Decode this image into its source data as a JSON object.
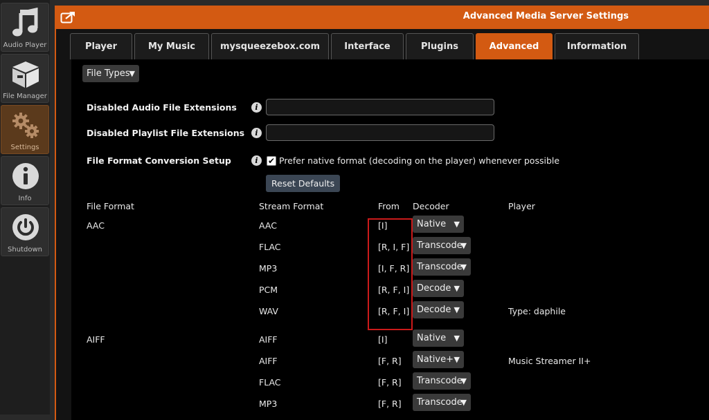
{
  "sidebar": {
    "items": [
      {
        "label": "Audio Player",
        "icon": "music-note-icon",
        "active": false
      },
      {
        "label": "File Manager",
        "icon": "box-icon",
        "active": false
      },
      {
        "label": "Settings",
        "icon": "gears-icon",
        "active": true
      },
      {
        "label": "Info",
        "icon": "info-icon",
        "active": false
      },
      {
        "label": "Shutdown",
        "icon": "power-icon",
        "active": false
      }
    ]
  },
  "window": {
    "title": "Advanced Media Server Settings",
    "accent": "#d35a12"
  },
  "tabs": [
    {
      "label": "Player"
    },
    {
      "label": "My Music"
    },
    {
      "label": "mysqueezebox.com"
    },
    {
      "label": "Interface"
    },
    {
      "label": "Plugins"
    },
    {
      "label": "Advanced",
      "active": true
    },
    {
      "label": "Information"
    }
  ],
  "section_dropdown": {
    "label": "File Types"
  },
  "settings": {
    "disabled_audio": {
      "label": "Disabled Audio File Extensions",
      "value": ""
    },
    "disabled_playlist": {
      "label": "Disabled Playlist File Extensions",
      "value": ""
    },
    "conversion": {
      "label": "File Format Conversion Setup",
      "checkbox_label": "Prefer native format (decoding on the player) whenever possible",
      "checked": true,
      "reset_label": "Reset Defaults"
    }
  },
  "table": {
    "headers": {
      "file_format": "File Format",
      "stream_format": "Stream Format",
      "from": "From",
      "decoder": "Decoder",
      "player": "Player"
    },
    "rows": [
      {
        "file_format": "AAC",
        "stream_format": "AAC",
        "from": "[I]",
        "decoder": "Native",
        "player": ""
      },
      {
        "file_format": "",
        "stream_format": "FLAC",
        "from": "[R, I, F]",
        "decoder": "Transcode",
        "player": ""
      },
      {
        "file_format": "",
        "stream_format": "MP3",
        "from": "[I, F, R]",
        "decoder": "Transcode",
        "player": ""
      },
      {
        "file_format": "",
        "stream_format": "PCM",
        "from": "[R, F, I]",
        "decoder": "Decode",
        "player": ""
      },
      {
        "file_format": "",
        "stream_format": "WAV",
        "from": "[R, F, I]",
        "decoder": "Decode",
        "player": "Type: daphile"
      },
      {
        "file_format": "AIFF",
        "stream_format": "AIFF",
        "from": "[I]",
        "decoder": "Native",
        "player": ""
      },
      {
        "file_format": "",
        "stream_format": "AIFF",
        "from": "[F, R]",
        "decoder": "Native+",
        "player": "Music Streamer II+"
      },
      {
        "file_format": "",
        "stream_format": "FLAC",
        "from": "[F, R]",
        "decoder": "Transcode",
        "player": ""
      },
      {
        "file_format": "",
        "stream_format": "MP3",
        "from": "[F, R]",
        "decoder": "Transcode",
        "player": ""
      }
    ]
  },
  "caret_glyph": "▼",
  "info_glyph": "i",
  "check_glyph": "✔"
}
